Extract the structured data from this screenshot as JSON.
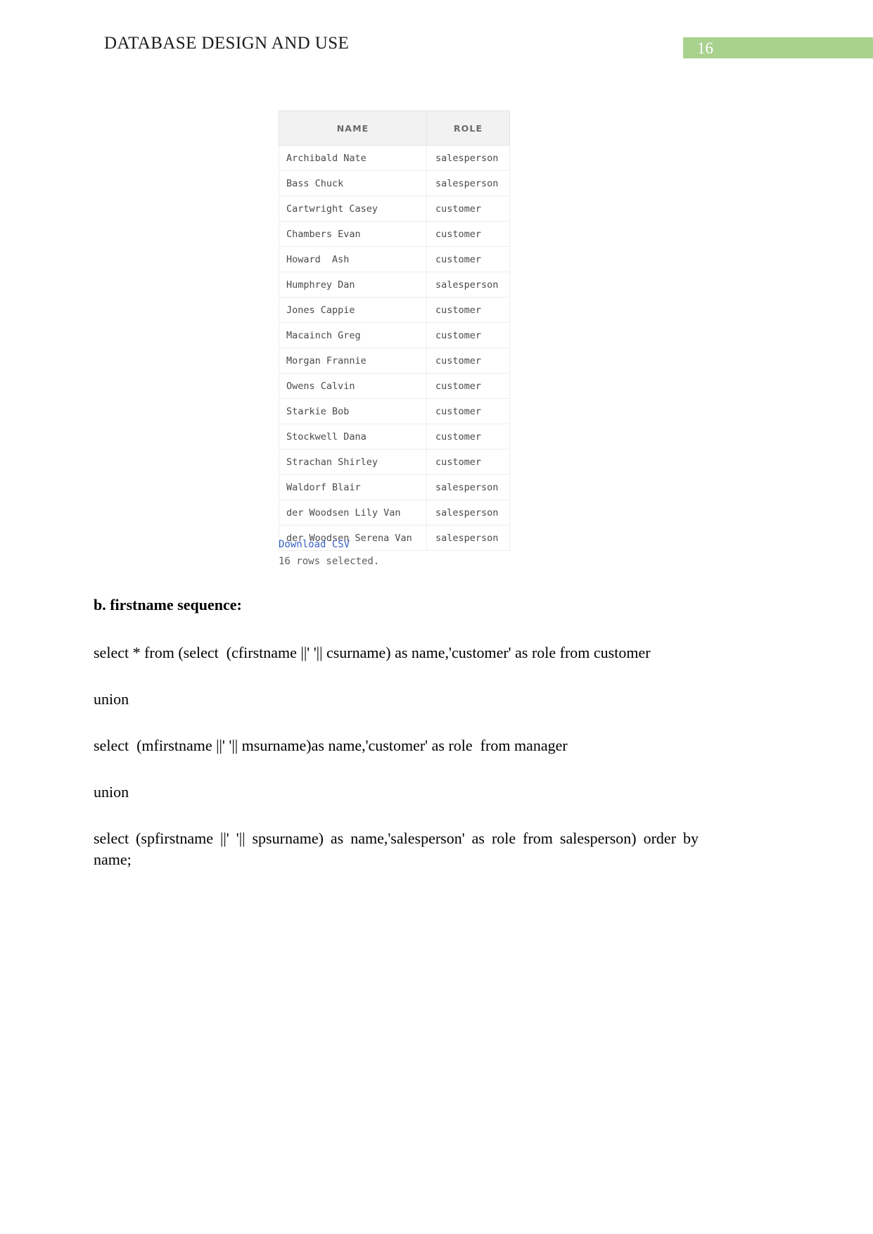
{
  "header": {
    "title": "DATABASE DESIGN AND USE",
    "page_number": "16",
    "badge_color": "#a9d18e"
  },
  "result": {
    "columns": [
      "NAME",
      "ROLE"
    ],
    "rows": [
      [
        "Archibald Nate",
        "salesperson"
      ],
      [
        "Bass Chuck",
        "salesperson"
      ],
      [
        "Cartwright Casey",
        "customer"
      ],
      [
        "Chambers Evan",
        "customer"
      ],
      [
        "Howard  Ash",
        "customer"
      ],
      [
        "Humphrey Dan",
        "salesperson"
      ],
      [
        "Jones Cappie",
        "customer"
      ],
      [
        "Macainch Greg",
        "customer"
      ],
      [
        "Morgan Frannie",
        "customer"
      ],
      [
        "Owens Calvin",
        "customer"
      ],
      [
        "Starkie Bob",
        "customer"
      ],
      [
        "Stockwell Dana",
        "customer"
      ],
      [
        "Strachan Shirley",
        "customer"
      ],
      [
        "Waldorf Blair",
        "salesperson"
      ],
      [
        "der Woodsen Lily Van",
        "salesperson"
      ],
      [
        "der Woodsen Serena Van",
        "salesperson"
      ]
    ],
    "download_link": "Download CSV",
    "rows_selected": "16 rows selected.",
    "link_color": "#3a62c4"
  },
  "body": {
    "sub_heading": "b. firstname sequence:",
    "lines": [
      "select * from (select  (cfirstname ||' '|| csurname) as name,'customer' as role from customer",
      "union",
      "select  (mfirstname ||' '|| msurname)as name,'customer' as role  from manager",
      "union",
      "select (spfirstname ||' '|| spsurname) as name,'salesperson' as role from salesperson) order by name;"
    ]
  }
}
